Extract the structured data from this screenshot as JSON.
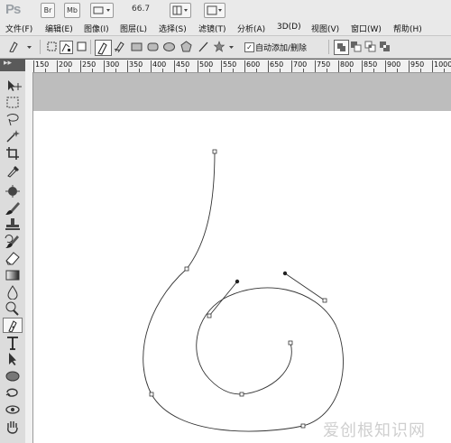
{
  "app": {
    "logo": "Ps",
    "bridge_btn": "Br",
    "minibridge_btn": "Mb",
    "zoom_level": "66.7"
  },
  "menu": {
    "items": [
      "文件(F)",
      "编辑(E)",
      "图像(I)",
      "图层(L)",
      "选择(S)",
      "滤镜(T)",
      "分析(A)",
      "3D(D)",
      "视图(V)",
      "窗口(W)",
      "帮助(H)"
    ]
  },
  "options": {
    "auto_add_delete_label": "自动添加/删除",
    "auto_add_delete_checked": true
  },
  "ruler": {
    "labels": [
      "150",
      "200",
      "250",
      "300",
      "350",
      "400",
      "450",
      "500",
      "550",
      "600",
      "650",
      "700",
      "750",
      "800",
      "850",
      "900",
      "950",
      "1000"
    ]
  },
  "tools": [
    "move-tool",
    "marquee-tool",
    "lasso-tool",
    "magic-wand-tool",
    "crop-tool",
    "eyedropper-tool",
    "healing-brush-tool",
    "brush-tool",
    "clone-stamp-tool",
    "history-brush-tool",
    "eraser-tool",
    "gradient-tool",
    "blur-tool",
    "dodge-tool",
    "pen-tool",
    "type-tool",
    "path-selection-tool",
    "shape-tool",
    "rotate-3d-tool",
    "orbit-3d-tool",
    "hand-tool"
  ],
  "active_tool": "pen-tool",
  "watermark": "爱创根知识网",
  "colors": {
    "canvas": "#ffffff",
    "path": "#333333",
    "chrome": "#e4e4e4"
  }
}
